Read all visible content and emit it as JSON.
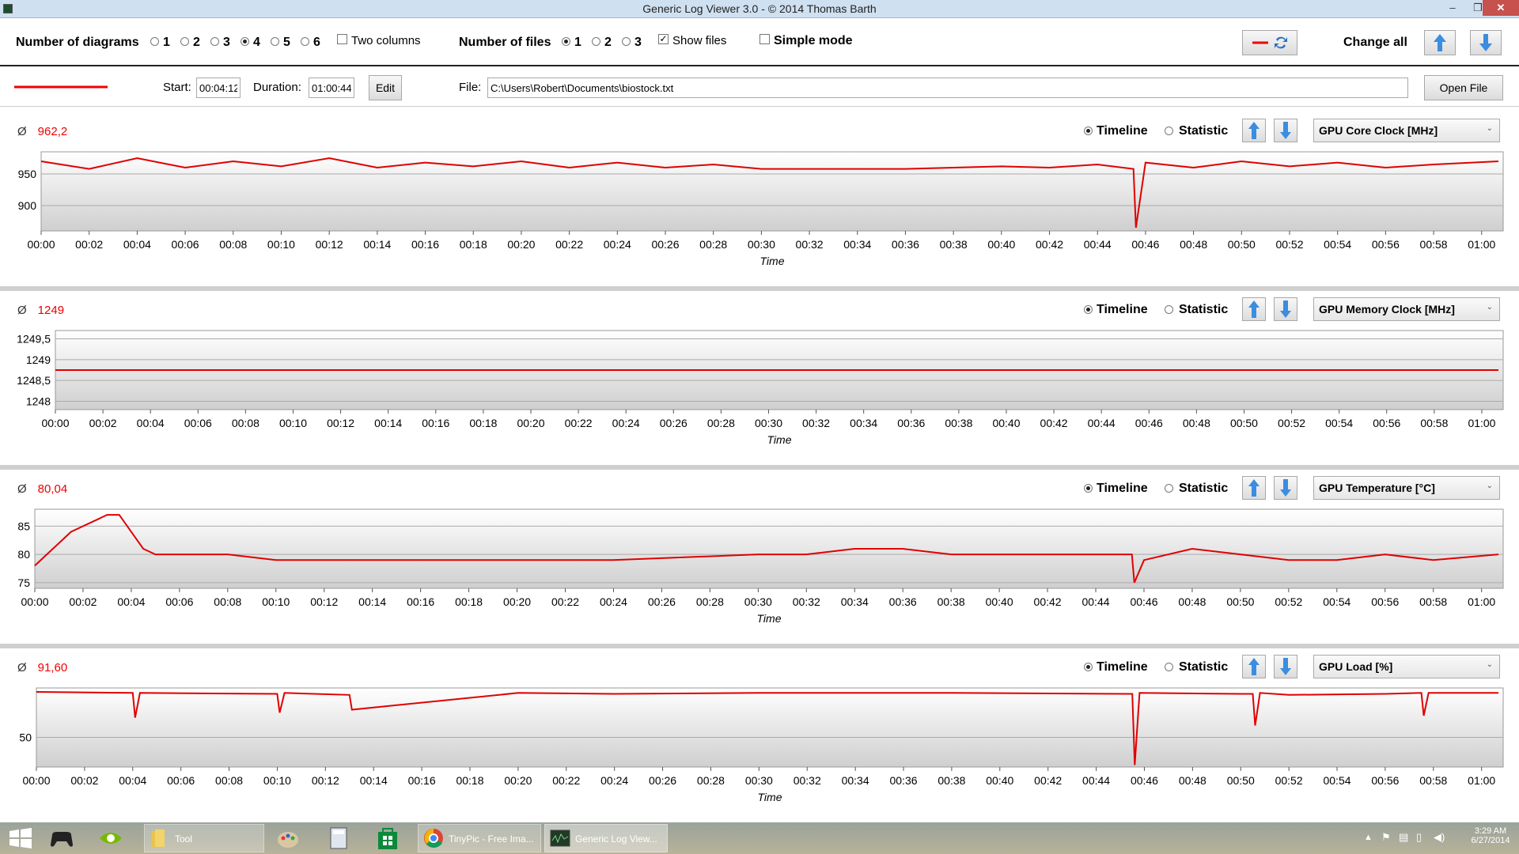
{
  "window": {
    "title": "Generic Log Viewer 3.0 - © 2014 Thomas Barth",
    "minimize": "–",
    "maximize": "❐",
    "close": "✕"
  },
  "toolbar": {
    "diagrams_label": "Number of diagrams",
    "diagram_options": [
      "1",
      "2",
      "3",
      "4",
      "5",
      "6"
    ],
    "diagrams_selected": "4",
    "two_columns": "Two columns",
    "files_label": "Number of files",
    "file_options": [
      "1",
      "2",
      "3"
    ],
    "files_selected": "1",
    "show_files": "Show files",
    "simple_mode": "Simple mode",
    "change_all": "Change all"
  },
  "file_bar": {
    "start_label": "Start:",
    "start_value": "00:04:12",
    "duration_label": "Duration:",
    "duration_value": "01:00:44",
    "edit": "Edit",
    "file_label": "File:",
    "file_path": "C:\\Users\\Robert\\Documents\\biostock.txt",
    "open_file": "Open File",
    "line_color": "#e00000"
  },
  "diagram_controls": {
    "avg_symbol": "Ø",
    "timeline": "Timeline",
    "statistic": "Statistic"
  },
  "x_ticks": [
    "00:00",
    "00:02",
    "00:04",
    "00:06",
    "00:08",
    "00:10",
    "00:12",
    "00:14",
    "00:16",
    "00:18",
    "00:20",
    "00:22",
    "00:24",
    "00:26",
    "00:28",
    "00:30",
    "00:32",
    "00:34",
    "00:36",
    "00:38",
    "00:40",
    "00:42",
    "00:44",
    "00:46",
    "00:48",
    "00:50",
    "00:52",
    "00:54",
    "00:56",
    "00:58",
    "01:00"
  ],
  "x_label": "Time",
  "chart_data": [
    {
      "type": "line",
      "sensor": "GPU Core Clock [MHz]",
      "average": "962,2",
      "xlabel": "Time",
      "y_ticks": [
        "950",
        "900"
      ],
      "ylim": [
        860,
        985
      ],
      "series": [
        {
          "x": [
            0,
            2,
            4,
            6,
            8,
            10,
            12,
            14,
            16,
            18,
            20,
            22,
            24,
            26,
            28,
            30,
            32,
            34,
            36,
            38,
            40,
            42,
            44,
            45.5,
            45.6,
            46,
            48,
            50,
            52,
            54,
            56,
            58,
            60.7
          ],
          "values": [
            970,
            958,
            975,
            960,
            970,
            962,
            975,
            960,
            968,
            962,
            970,
            960,
            968,
            960,
            965,
            958,
            958,
            958,
            958,
            960,
            962,
            960,
            965,
            958,
            865,
            968,
            960,
            970,
            962,
            968,
            960,
            965,
            970
          ]
        }
      ]
    },
    {
      "type": "line",
      "sensor": "GPU Memory Clock [MHz]",
      "average": "1249",
      "xlabel": "Time",
      "y_ticks": [
        "1249,5",
        "1249",
        "1248,5",
        "1248"
      ],
      "ylim": [
        1247.8,
        1249.7
      ],
      "series": [
        {
          "x": [
            0,
            60.7
          ],
          "values": [
            1248.75,
            1248.75
          ]
        }
      ]
    },
    {
      "type": "line",
      "sensor": "GPU Temperature [°C]",
      "average": "80,04",
      "xlabel": "Time",
      "y_ticks": [
        "85",
        "80",
        "75"
      ],
      "ylim": [
        74,
        88
      ],
      "series": [
        {
          "x": [
            0,
            0.5,
            1,
            1.5,
            2,
            2.5,
            3,
            3.5,
            4,
            4.5,
            5,
            6,
            8,
            10,
            20,
            24,
            30,
            32,
            34,
            36,
            38,
            40,
            42,
            44,
            45.5,
            45.6,
            46,
            48,
            50,
            52,
            54,
            56,
            58,
            60.7
          ],
          "values": [
            78,
            80,
            82,
            84,
            85,
            86,
            87,
            87,
            84,
            81,
            80,
            80,
            80,
            79,
            79,
            79,
            80,
            80,
            81,
            81,
            80,
            80,
            80,
            80,
            80,
            75,
            79,
            81,
            80,
            79,
            79,
            80,
            79,
            80
          ]
        }
      ]
    },
    {
      "type": "line",
      "sensor": "GPU Load [%]",
      "average": "91,60",
      "xlabel": "Time",
      "y_ticks": [
        "50"
      ],
      "ylim": [
        20,
        100
      ],
      "series": [
        {
          "x": [
            0,
            4,
            4.1,
            4.3,
            10,
            10.1,
            10.3,
            13,
            13.1,
            20,
            24,
            30,
            38,
            45.5,
            45.6,
            45.8,
            50,
            50.5,
            50.6,
            50.8,
            52,
            56,
            57.5,
            57.6,
            57.8,
            60.7
          ],
          "values": [
            96,
            95,
            70,
            95,
            94,
            75,
            95,
            93,
            78,
            95,
            94,
            95,
            95,
            94,
            22,
            95,
            94,
            94,
            62,
            95,
            93,
            94,
            95,
            72,
            95,
            95
          ]
        }
      ]
    }
  ],
  "taskbar": {
    "items": [
      {
        "label": "Tool",
        "icon": "folder-icon"
      },
      {
        "label": "TinyPic - Free Ima...",
        "icon": "chrome-icon"
      },
      {
        "label": "Generic Log View...",
        "icon": "app-icon"
      }
    ],
    "time": "3:29 AM",
    "date": "6/27/2014"
  }
}
